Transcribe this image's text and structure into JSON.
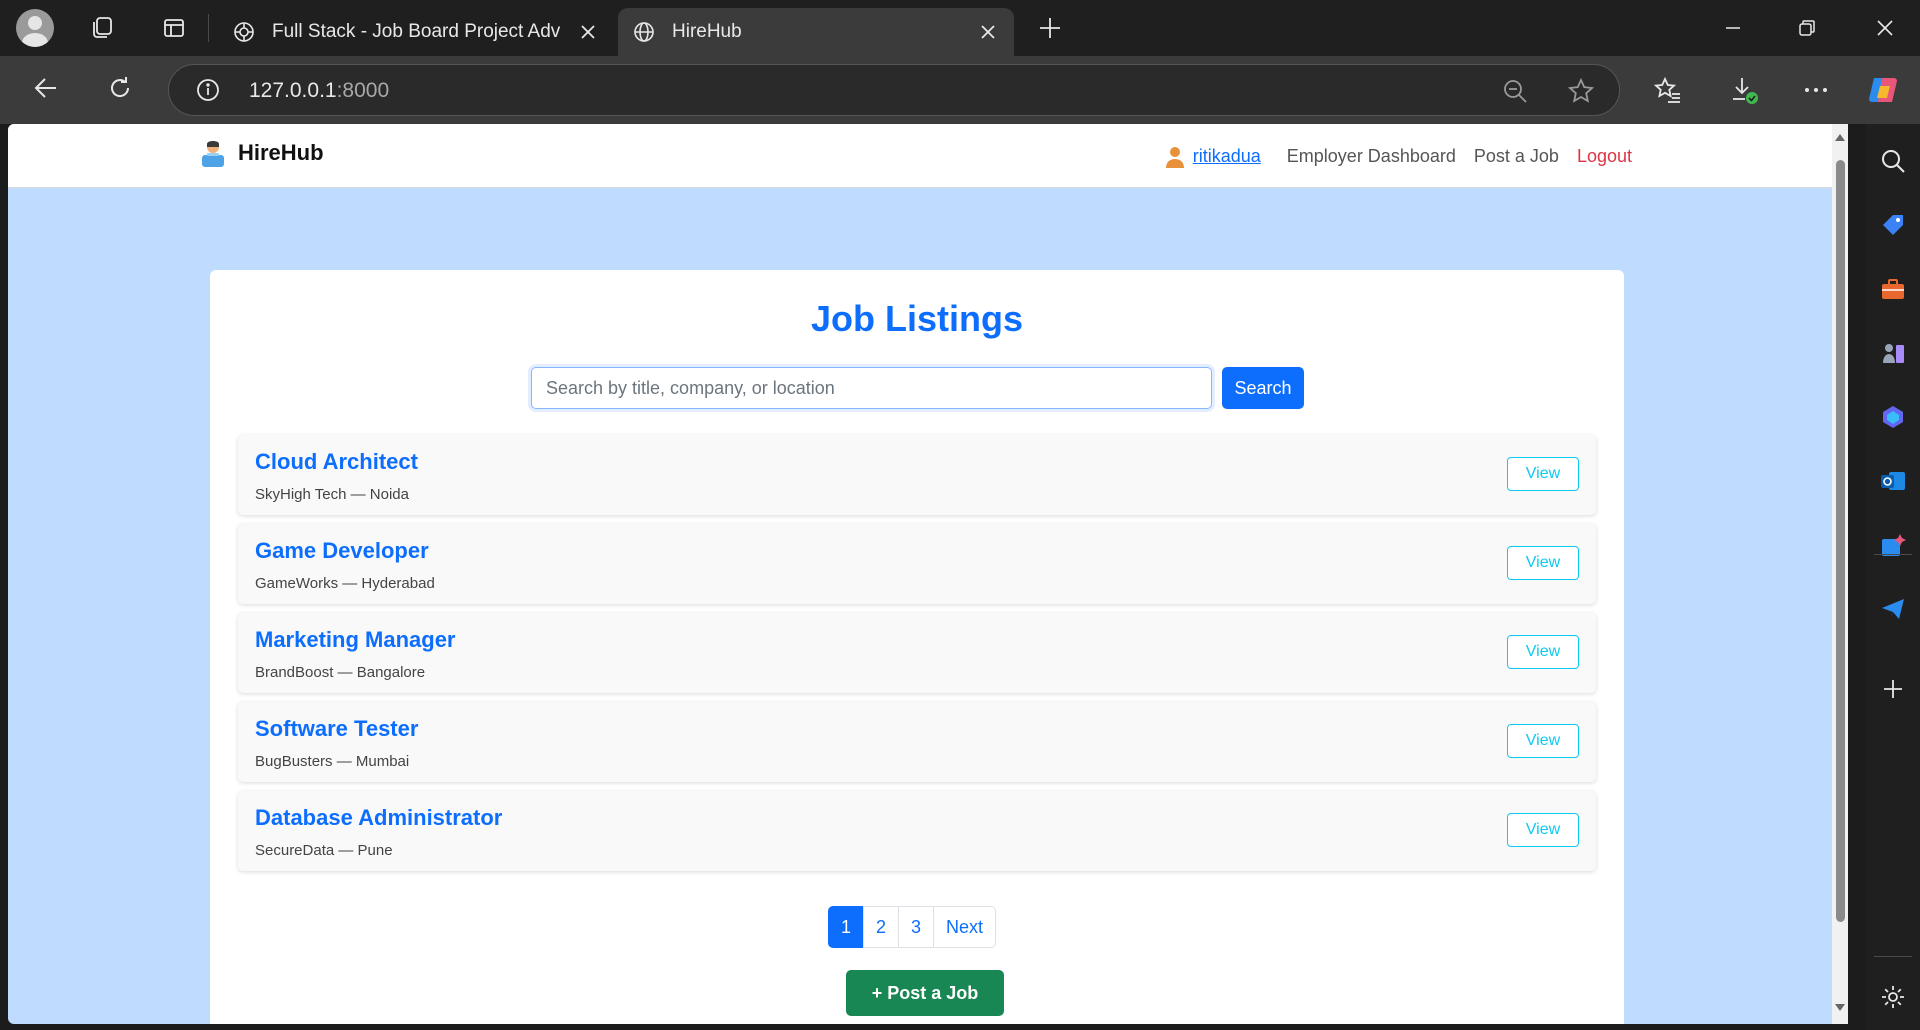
{
  "browser": {
    "tabs": [
      {
        "title": "Full Stack - Job Board Project Adv",
        "icon": "chatgpt-icon"
      },
      {
        "title": "HireHub",
        "icon": "globe-icon"
      }
    ],
    "url_host": "127.0.0.1",
    "url_port": ":8000"
  },
  "site": {
    "brand": "HireHub",
    "nav": {
      "username": "ritikadua",
      "employer_dashboard": "Employer Dashboard",
      "post_job": "Post a Job",
      "logout": "Logout"
    }
  },
  "main": {
    "title": "Job Listings",
    "search_placeholder": "Search by title, company, or location",
    "search_button": "Search",
    "jobs": [
      {
        "title": "Cloud Architect",
        "meta": "SkyHigh Tech — Noida",
        "view": "View"
      },
      {
        "title": "Game Developer",
        "meta": "GameWorks — Hyderabad",
        "view": "View"
      },
      {
        "title": "Marketing Manager",
        "meta": "BrandBoost — Bangalore",
        "view": "View"
      },
      {
        "title": "Software Tester",
        "meta": "BugBusters — Mumbai",
        "view": "View"
      },
      {
        "title": "Database Administrator",
        "meta": "SecureData — Pune",
        "view": "View"
      }
    ],
    "pagination": [
      "1",
      "2",
      "3",
      "Next"
    ],
    "post_job_button": "+ Post a Job"
  },
  "colors": {
    "primary": "#0d6efd",
    "page_background": "#bfdbfe",
    "success": "#198754",
    "danger": "#dc3545",
    "info": "#0dcaf0"
  }
}
